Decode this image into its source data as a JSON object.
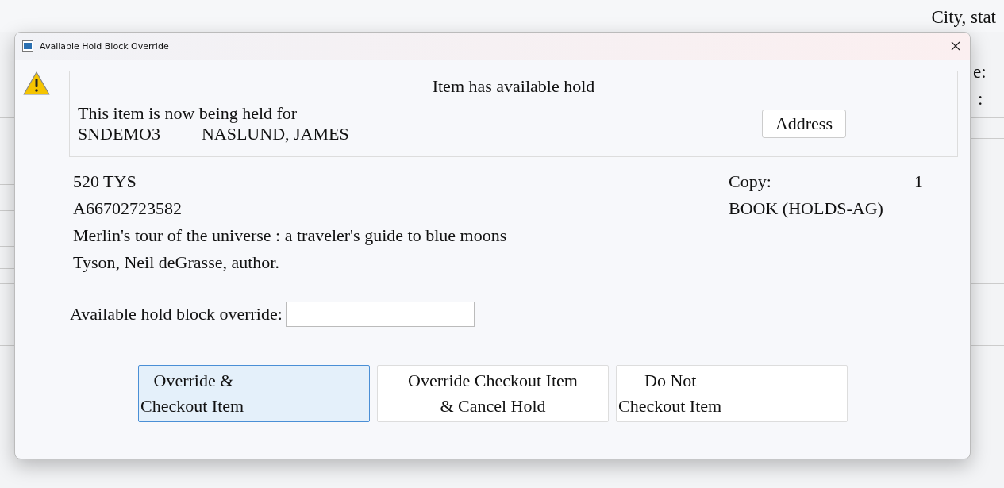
{
  "background": {
    "texts": [
      "City, stat",
      "e:",
      ":"
    ]
  },
  "window": {
    "title": "Available Hold Block Override"
  },
  "message": {
    "heading": "Item has available hold",
    "text": "This item is now being held for",
    "patron_id": "SNDEMO3",
    "patron_name": "NASLUND, JAMES",
    "address_button": "Address"
  },
  "item": {
    "lines": [
      "520 TYS",
      "A66702723582",
      "Merlin's tour of the universe : a traveler's guide to blue moons",
      "Tyson, Neil deGrasse, author."
    ],
    "copy_label": "Copy:",
    "copy_value": "1",
    "format": "BOOK (HOLDS-AG)"
  },
  "override_field": {
    "label": "Available hold block override:"
  },
  "buttons": [
    {
      "label": "   Override &\nCheckout Item",
      "selected": true
    },
    {
      "label": "Override Checkout Item\n& Cancel Hold",
      "selected": false
    },
    {
      "label": "      Do Not\nCheckout Item",
      "selected": false
    }
  ]
}
